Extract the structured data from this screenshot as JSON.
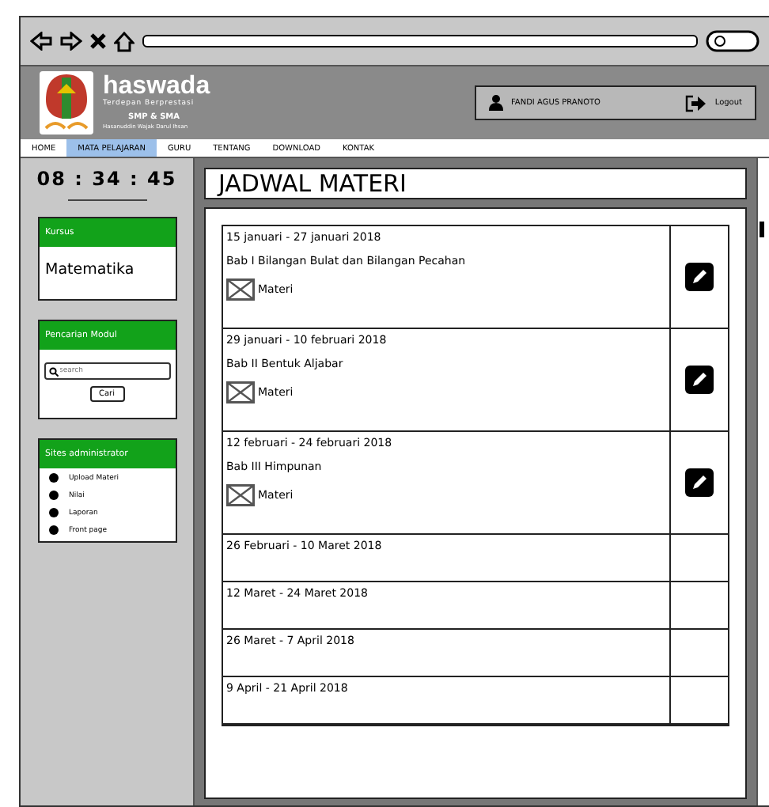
{
  "header": {
    "brand": "haswada",
    "tagline": "Terdepan Berprestasi",
    "school": "SMP & SMA",
    "school_sub": "Hasanuddin Wajak Darul Ihsan",
    "user": "FANDI AGUS PRANOTO",
    "logout": "Logout"
  },
  "nav": [
    {
      "label": "HOME",
      "selected": false
    },
    {
      "label": "MATA PELAJARAN",
      "selected": true
    },
    {
      "label": "GURU",
      "selected": false
    },
    {
      "label": "TENTANG",
      "selected": false
    },
    {
      "label": "DOWNLOAD",
      "selected": false
    },
    {
      "label": "KONTAK",
      "selected": false
    }
  ],
  "clock": "08 : 34 : 45",
  "kursus": {
    "title": "Kursus",
    "value": "Matematika"
  },
  "search_panel": {
    "title": "Pencarian Modul",
    "placeholder": "search",
    "button": "Cari"
  },
  "admin": {
    "title": "Sites administrator",
    "items": [
      "Upload Materi",
      "Nilai",
      "Laporan",
      "Front page"
    ]
  },
  "page_title": "JADWAL MATERI",
  "schedule": [
    {
      "kind": "detail",
      "date": "15 januari - 27 januari 2018",
      "chapter": "Bab I Bilangan Bulat dan Bilangan Pecahan",
      "material": "Materi"
    },
    {
      "kind": "detail",
      "date": "29 januari - 10 februari 2018",
      "chapter": "Bab II Bentuk Aljabar",
      "material": "Materi"
    },
    {
      "kind": "detail",
      "date": "12 februari - 24 februari 2018",
      "chapter": "Bab III Himpunan",
      "material": "Materi"
    },
    {
      "kind": "date",
      "date": "26 Februari - 10 Maret 2018"
    },
    {
      "kind": "date",
      "date": "12 Maret - 24 Maret 2018"
    },
    {
      "kind": "date",
      "date": "26 Maret - 7 April 2018"
    },
    {
      "kind": "date",
      "date": "9 April - 21 April 2018"
    }
  ]
}
